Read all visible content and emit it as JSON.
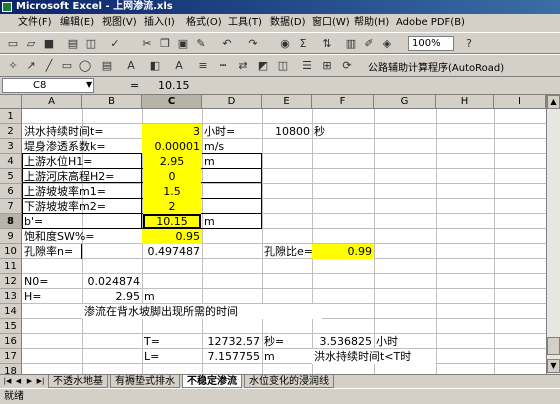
{
  "window": {
    "title": "Microsoft Excel - 上网渗流.xls"
  },
  "menu": [
    "文件(F)",
    "编辑(E)",
    "视图(V)",
    "插入(I)",
    "格式(O)",
    "工具(T)",
    "数据(D)",
    "窗口(W)",
    "帮助(H)",
    "Adobe PDF(B)"
  ],
  "toolbar": {
    "zoom": "100%",
    "addin": "公路辅助计算程序(AutoRoad)"
  },
  "formula_bar": {
    "name_box": "C8",
    "fx": "=",
    "content": "10.15"
  },
  "columns": [
    "A",
    "B",
    "C",
    "D",
    "E",
    "F",
    "G",
    "H",
    "I"
  ],
  "rows": [
    "1",
    "2",
    "3",
    "4",
    "5",
    "6",
    "7",
    "8",
    "9",
    "10",
    "11",
    "12",
    "13",
    "14",
    "15",
    "16",
    "17",
    "18"
  ],
  "cells": {
    "A2": "洪水持续时间t=",
    "C2": "3",
    "D2": "小时=",
    "E2": "10800",
    "F2": "秒",
    "A3": "堤身渗透系数k=",
    "C3": "0.00001",
    "D3": "m/s",
    "A4": "上游水位H1=",
    "C4": "2.95",
    "D4": "m",
    "A5": "上游河床高程H2=",
    "C5": "0",
    "A6": "上游坡坡率m1=",
    "C6": "1.5",
    "A7": "下游坡坡率m2=",
    "C7": "2",
    "A8": "b'=",
    "C8": "10.15",
    "D8": "m",
    "A9": "饱和度SW%=",
    "C9": "0.95",
    "A10": "孔隙率n=",
    "C10": "0.497487",
    "E10": "孔隙比e=",
    "F10": "0.99",
    "A12": "N0=",
    "B12": "0.024874",
    "A13": "H=",
    "B13": "2.95",
    "C13": "m",
    "B14": "渗流在背水坡脚出现所需的时间",
    "C16": "T=",
    "D16": "12732.57",
    "E16": "秒=",
    "F16": "3.536825",
    "G16": "小时",
    "C17": "L=",
    "D17": "7.157755",
    "E17": "m",
    "F17": "洪水持续时间t<T时"
  },
  "sheet_tabs": [
    "不透水地基",
    "有褥垫式排水",
    "不稳定渗流",
    "水位变化的浸润线"
  ],
  "active_tab": "不稳定渗流",
  "status": "就绪",
  "colors": {
    "highlight": "#ffff00",
    "title_bar": "#0a246a"
  },
  "icons": [
    "excel-app-icon",
    "new-icon",
    "open-icon",
    "save-icon",
    "print-icon",
    "cut-icon",
    "copy-icon",
    "paste-icon",
    "undo-icon",
    "sum-icon",
    "sort-icon",
    "chart-icon",
    "help-icon"
  ]
}
